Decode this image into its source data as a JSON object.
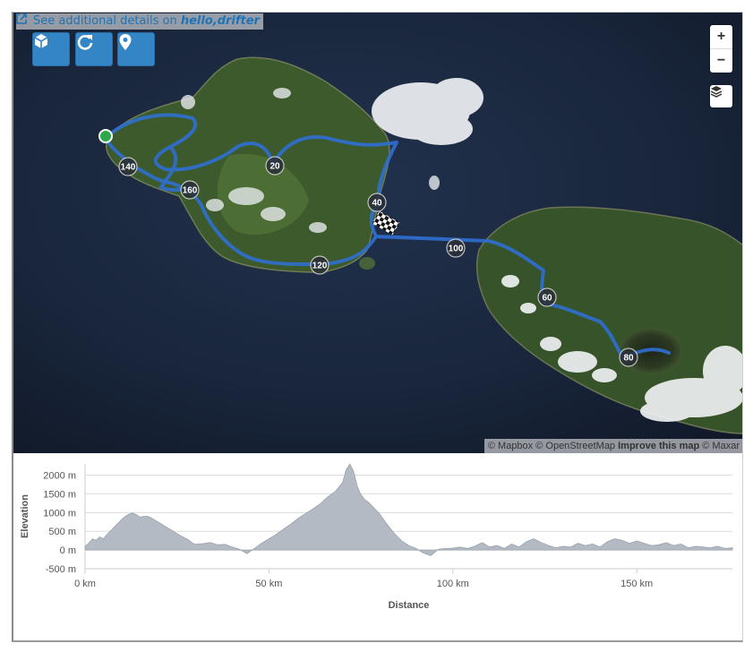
{
  "header": {
    "link_prefix": "See additional details on ",
    "link_brand": "hello,drifter",
    "link_icon": "external-link-icon"
  },
  "toolbar": {
    "buttons": [
      {
        "name": "3d-view-button",
        "icon": "cube-icon"
      },
      {
        "name": "replay-button",
        "icon": "refresh-icon"
      },
      {
        "name": "location-button",
        "icon": "map-marker-icon"
      }
    ]
  },
  "map_controls": {
    "zoom_in": "+",
    "zoom_out": "−",
    "layers_icon": "layers-icon"
  },
  "attribution": {
    "mapbox": "© Mapbox",
    "osm": "© OpenStreetMap",
    "improve": "Improve this map",
    "maxar": "© Maxar"
  },
  "route": {
    "color": "#2f6fd0",
    "start_color": "#2aa84a",
    "km_markers": [
      "20",
      "40",
      "60",
      "80",
      "100",
      "120",
      "140",
      "160"
    ]
  },
  "chart_data": {
    "type": "area",
    "title": "",
    "xlabel": "Distance",
    "ylabel": "Elevation",
    "x_ticks": [
      "0 km",
      "50 km",
      "100 km",
      "150 km"
    ],
    "y_ticks": [
      "2000 m",
      "1500 m",
      "1000 m",
      "500 m",
      "0 m",
      "-500 m"
    ],
    "xlim": [
      0,
      176
    ],
    "ylim": [
      -500,
      2300
    ],
    "fill_color": "#b3bac3",
    "grid": true,
    "series": [
      {
        "x": [
          0,
          1,
          2,
          3,
          4,
          5,
          6,
          7,
          8,
          9,
          10,
          11,
          12,
          13,
          14,
          15,
          16,
          17,
          18,
          19,
          20,
          22,
          24,
          26,
          28,
          29,
          30,
          32,
          34,
          36,
          38,
          40,
          42,
          44,
          46,
          48,
          50,
          52,
          54,
          56,
          58,
          60,
          62,
          64,
          66,
          68,
          70,
          71,
          72,
          73,
          74,
          75,
          76,
          77,
          78,
          79,
          80,
          82,
          84,
          86,
          88,
          90,
          92,
          94,
          96,
          98,
          100,
          102,
          104,
          106,
          108,
          110,
          112,
          114,
          116,
          118,
          120,
          122,
          124,
          126,
          128,
          130,
          132,
          134,
          136,
          138,
          140,
          142,
          144,
          146,
          148,
          150,
          152,
          154,
          156,
          158,
          160,
          162,
          164,
          166,
          168,
          170,
          172,
          174,
          176
        ],
        "y": [
          100,
          180,
          300,
          260,
          350,
          300,
          420,
          520,
          620,
          720,
          820,
          900,
          960,
          990,
          940,
          880,
          900,
          900,
          860,
          800,
          740,
          620,
          500,
          380,
          280,
          200,
          150,
          170,
          200,
          140,
          150,
          80,
          20,
          -100,
          40,
          180,
          300,
          420,
          560,
          700,
          850,
          980,
          1100,
          1240,
          1420,
          1560,
          1800,
          2150,
          2300,
          2100,
          1700,
          1480,
          1350,
          1280,
          1180,
          1080,
          980,
          700,
          450,
          250,
          120,
          40,
          -80,
          -150,
          20,
          40,
          50,
          80,
          40,
          100,
          200,
          80,
          120,
          40,
          160,
          80,
          220,
          300,
          200,
          120,
          60,
          100,
          80,
          180,
          120,
          160,
          80,
          220,
          300,
          260,
          180,
          240,
          180,
          120,
          140,
          200,
          120,
          160,
          60,
          100,
          80,
          60,
          100,
          40,
          60
        ]
      }
    ]
  }
}
